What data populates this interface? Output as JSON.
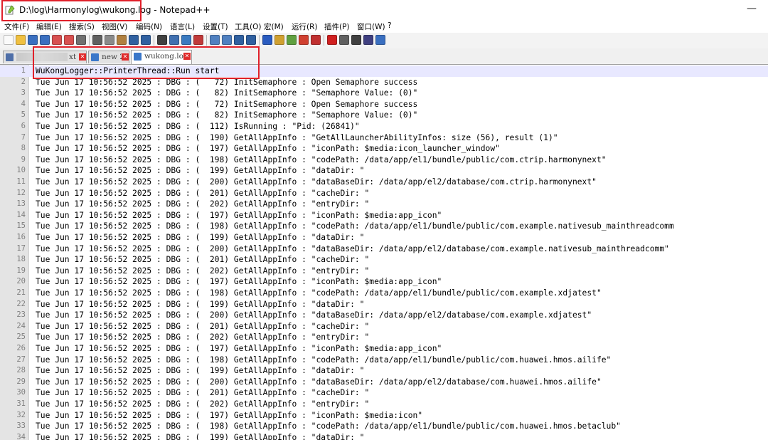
{
  "window": {
    "title": "D:\\log\\Harmonylog\\wukong.log - Notepad++",
    "minimize_glyph": "—"
  },
  "menu": [
    "文件(F)",
    "编辑(E)",
    "搜索(S)",
    "视图(V)",
    "编码(N)",
    "语言(L)",
    "设置(T)",
    "工具(O)",
    "宏(M)",
    "运行(R)",
    "插件(P)",
    "窗口(W)",
    "?"
  ],
  "tabs": [
    {
      "label": "xt",
      "blurred": true,
      "active": false
    },
    {
      "label": "new 2",
      "blurred": false,
      "active": false
    },
    {
      "label": "wukong.log",
      "blurred": false,
      "active": true
    }
  ],
  "lines": [
    "WuKongLogger::PrinterThread::Run start",
    "Tue Jun 17 10:56:52 2025 : DBG : (   72) InitSemaphore : Open Semaphore success",
    "Tue Jun 17 10:56:52 2025 : DBG : (   82) InitSemaphore : \"Semaphore Value: (0)\"",
    "Tue Jun 17 10:56:52 2025 : DBG : (   72) InitSemaphore : Open Semaphore success",
    "Tue Jun 17 10:56:52 2025 : DBG : (   82) InitSemaphore : \"Semaphore Value: (0)\"",
    "Tue Jun 17 10:56:52 2025 : DBG : (  112) IsRunning : \"Pid: (26841)\"",
    "Tue Jun 17 10:56:52 2025 : DBG : (  190) GetAllAppInfo : \"GetAllLauncherAbilityInfos: size (56), result (1)\"",
    "Tue Jun 17 10:56:52 2025 : DBG : (  197) GetAllAppInfo : \"iconPath: $media:icon_launcher_window\"",
    "Tue Jun 17 10:56:52 2025 : DBG : (  198) GetAllAppInfo : \"codePath: /data/app/el1/bundle/public/com.ctrip.harmonynext\"",
    "Tue Jun 17 10:56:52 2025 : DBG : (  199) GetAllAppInfo : \"dataDir: \"",
    "Tue Jun 17 10:56:52 2025 : DBG : (  200) GetAllAppInfo : \"dataBaseDir: /data/app/el2/database/com.ctrip.harmonynext\"",
    "Tue Jun 17 10:56:52 2025 : DBG : (  201) GetAllAppInfo : \"cacheDir: \"",
    "Tue Jun 17 10:56:52 2025 : DBG : (  202) GetAllAppInfo : \"entryDir: \"",
    "Tue Jun 17 10:56:52 2025 : DBG : (  197) GetAllAppInfo : \"iconPath: $media:app_icon\"",
    "Tue Jun 17 10:56:52 2025 : DBG : (  198) GetAllAppInfo : \"codePath: /data/app/el1/bundle/public/com.example.nativesub_mainthreadcomm",
    "Tue Jun 17 10:56:52 2025 : DBG : (  199) GetAllAppInfo : \"dataDir: \"",
    "Tue Jun 17 10:56:52 2025 : DBG : (  200) GetAllAppInfo : \"dataBaseDir: /data/app/el2/database/com.example.nativesub_mainthreadcomm\"",
    "Tue Jun 17 10:56:52 2025 : DBG : (  201) GetAllAppInfo : \"cacheDir: \"",
    "Tue Jun 17 10:56:52 2025 : DBG : (  202) GetAllAppInfo : \"entryDir: \"",
    "Tue Jun 17 10:56:52 2025 : DBG : (  197) GetAllAppInfo : \"iconPath: $media:app_icon\"",
    "Tue Jun 17 10:56:52 2025 : DBG : (  198) GetAllAppInfo : \"codePath: /data/app/el1/bundle/public/com.example.xdjatest\"",
    "Tue Jun 17 10:56:52 2025 : DBG : (  199) GetAllAppInfo : \"dataDir: \"",
    "Tue Jun 17 10:56:52 2025 : DBG : (  200) GetAllAppInfo : \"dataBaseDir: /data/app/el2/database/com.example.xdjatest\"",
    "Tue Jun 17 10:56:52 2025 : DBG : (  201) GetAllAppInfo : \"cacheDir: \"",
    "Tue Jun 17 10:56:52 2025 : DBG : (  202) GetAllAppInfo : \"entryDir: \"",
    "Tue Jun 17 10:56:52 2025 : DBG : (  197) GetAllAppInfo : \"iconPath: $media:app_icon\"",
    "Tue Jun 17 10:56:52 2025 : DBG : (  198) GetAllAppInfo : \"codePath: /data/app/el1/bundle/public/com.huawei.hmos.ailife\"",
    "Tue Jun 17 10:56:52 2025 : DBG : (  199) GetAllAppInfo : \"dataDir: \"",
    "Tue Jun 17 10:56:52 2025 : DBG : (  200) GetAllAppInfo : \"dataBaseDir: /data/app/el2/database/com.huawei.hmos.ailife\"",
    "Tue Jun 17 10:56:52 2025 : DBG : (  201) GetAllAppInfo : \"cacheDir: \"",
    "Tue Jun 17 10:56:52 2025 : DBG : (  202) GetAllAppInfo : \"entryDir: \"",
    "Tue Jun 17 10:56:52 2025 : DBG : (  197) GetAllAppInfo : \"iconPath: $media:icon\"",
    "Tue Jun 17 10:56:52 2025 : DBG : (  198) GetAllAppInfo : \"codePath: /data/app/el1/bundle/public/com.huawei.hmos.betaclub\"",
    "Tue Jun 17 10:56:52 2025 : DBG : (  199) GetAllAppInfo : \"dataDir: \""
  ],
  "colors": {
    "annotation": "#e0202a",
    "current_line": "#e8e8ff",
    "tab_close": "#e02a2a"
  },
  "toolbar_icons": [
    "new-file-icon",
    "open-file-icon",
    "save-icon",
    "save-all-icon",
    "close-icon",
    "close-all-icon",
    "print-icon",
    "cut-icon",
    "copy-icon",
    "paste-icon",
    "undo-icon",
    "redo-icon",
    "find-icon",
    "replace-icon",
    "zoom-in-icon",
    "zoom-out-icon",
    "sync-vertical-icon",
    "sync-horizontal-icon",
    "word-wrap-icon",
    "show-all-chars-icon",
    "indent-guide-icon",
    "doc-map-icon",
    "function-list-icon",
    "folder-workspace-icon",
    "monitor-icon",
    "record-macro-icon",
    "stop-macro-icon",
    "play-macro-icon",
    "run-macro-multi-icon",
    "save-macro-icon"
  ]
}
